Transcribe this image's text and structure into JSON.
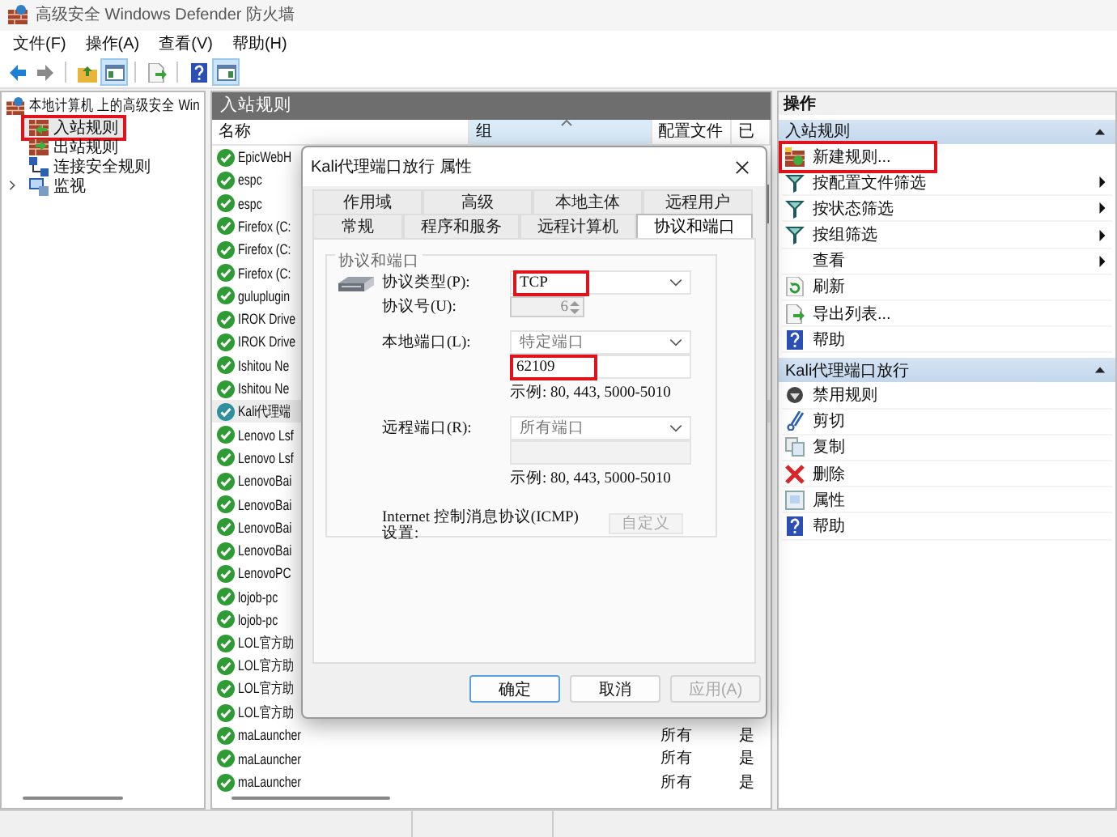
{
  "window": {
    "title": "高级安全 Windows Defender 防火墙"
  },
  "menu": [
    "文件(F)",
    "操作(A)",
    "查看(V)",
    "帮助(H)"
  ],
  "toolbar": [
    {
      "kind": "back",
      "pressed": false
    },
    {
      "kind": "forward",
      "pressed": false
    },
    {
      "kind": "separator"
    },
    {
      "kind": "up",
      "pressed": false
    },
    {
      "kind": "tree",
      "pressed": true
    },
    {
      "kind": "separator"
    },
    {
      "kind": "export",
      "pressed": false
    },
    {
      "kind": "separator"
    },
    {
      "kind": "help",
      "pressed": false
    },
    {
      "kind": "panel",
      "pressed": true
    }
  ],
  "tree": {
    "label": "本地计算机 上的高级安全 Win",
    "expanded": true,
    "children": [
      {
        "label": "入站规则",
        "kind": "inbound",
        "selected": true,
        "highlighted": true
      },
      {
        "label": "出站规则",
        "kind": "outbound",
        "selected": false,
        "highlighted": false
      },
      {
        "label": "连接安全规则",
        "kind": "connection",
        "selected": false,
        "highlighted": false
      },
      {
        "label": "监视",
        "kind": "monitor",
        "selected": false,
        "highlighted": false,
        "expanded": false
      }
    ]
  },
  "rules_pane": {
    "title": "入站规则",
    "columns": [
      {
        "label": "名称",
        "sorted": false
      },
      {
        "label": "组",
        "sorted": true
      },
      {
        "label": "配置文件",
        "sorted": false
      },
      {
        "label": "已",
        "sorted": false
      }
    ],
    "rows": [
      {
        "name": "EpicWebH",
        "selected": false
      },
      {
        "name": "espc",
        "selected": false
      },
      {
        "name": "espc",
        "selected": false
      },
      {
        "name": "Firefox (C:",
        "selected": false
      },
      {
        "name": "Firefox (C:",
        "selected": false
      },
      {
        "name": "Firefox (C:",
        "selected": false
      },
      {
        "name": "guluplugin",
        "selected": false
      },
      {
        "name": "IROK Drive",
        "selected": false
      },
      {
        "name": "IROK Drive",
        "selected": false
      },
      {
        "name": "Ishitou Ne",
        "selected": false
      },
      {
        "name": "Ishitou Ne",
        "selected": false
      },
      {
        "name": "Kali代理端",
        "selected": true
      },
      {
        "name": "Lenovo Lsf",
        "selected": false
      },
      {
        "name": "Lenovo Lsf",
        "selected": false
      },
      {
        "name": "LenovoBai",
        "selected": false
      },
      {
        "name": "LenovoBai",
        "selected": false
      },
      {
        "name": "LenovoBai",
        "selected": false
      },
      {
        "name": "LenovoBai",
        "selected": false
      },
      {
        "name": "LenovoPC",
        "selected": false
      },
      {
        "name": "lojob-pc",
        "selected": false
      },
      {
        "name": "lojob-pc",
        "selected": false
      },
      {
        "name": "LOL官方助",
        "selected": false
      },
      {
        "name": "LOL官方助",
        "selected": false
      },
      {
        "name": "LOL官方助",
        "selected": false
      },
      {
        "name": "LOL官方助",
        "selected": false
      },
      {
        "name": "maLauncher",
        "profile": "所有",
        "column_4": "是",
        "selected": false
      },
      {
        "name": "maLauncher",
        "profile": "所有",
        "column_4": "是",
        "selected": false
      },
      {
        "name": "maLauncher",
        "profile": "所有",
        "column_4": "是",
        "selected": false
      }
    ]
  },
  "actions": {
    "title": "操作",
    "sections": [
      {
        "title": "入站规则",
        "expanded": true,
        "items": [
          {
            "label": "新建规则...",
            "kind": "new",
            "submenu": false,
            "highlighted": true
          },
          {
            "label": "按配置文件筛选",
            "kind": "filter",
            "submenu": true,
            "highlighted": false
          },
          {
            "label": "按状态筛选",
            "kind": "filter",
            "submenu": true,
            "highlighted": false
          },
          {
            "label": "按组筛选",
            "kind": "filter",
            "submenu": true,
            "highlighted": false
          },
          {
            "label": "查看",
            "kind": "none",
            "submenu": true,
            "highlighted": false
          },
          {
            "label": "刷新",
            "kind": "refresh",
            "submenu": false,
            "highlighted": false
          },
          {
            "label": "导出列表...",
            "kind": "export",
            "submenu": false,
            "highlighted": false
          },
          {
            "label": "帮助",
            "kind": "help",
            "submenu": false,
            "highlighted": false
          }
        ]
      },
      {
        "title": "Kali代理端口放行",
        "expanded": true,
        "items": [
          {
            "label": "禁用规则",
            "kind": "disable",
            "submenu": false,
            "highlighted": false
          },
          {
            "label": "剪切",
            "kind": "cut",
            "submenu": false,
            "highlighted": false
          },
          {
            "label": "复制",
            "kind": "copy",
            "submenu": false,
            "highlighted": false
          },
          {
            "label": "删除",
            "kind": "delete",
            "submenu": false,
            "highlighted": false
          },
          {
            "label": "属性",
            "kind": "properties",
            "submenu": false,
            "highlighted": false
          },
          {
            "label": "帮助",
            "kind": "help",
            "submenu": false,
            "highlighted": false
          }
        ]
      }
    ]
  },
  "dialog": {
    "title": "Kali代理端口放行 属性",
    "tab_rows": [
      [
        {
          "label": "作用域",
          "selected": false
        },
        {
          "label": "高级",
          "selected": false
        },
        {
          "label": "本地主体",
          "selected": false
        },
        {
          "label": "远程用户",
          "selected": false
        }
      ],
      [
        {
          "label": "常规",
          "selected": false
        },
        {
          "label": "程序和服务",
          "selected": false
        },
        {
          "label": "远程计算机",
          "selected": false
        },
        {
          "label": "协议和端口",
          "selected": true
        }
      ]
    ],
    "group_title": "协议和端口",
    "protocol_type": {
      "label": "协议类型(P):",
      "value": "TCP",
      "highlighted": true
    },
    "protocol_number": {
      "label": "协议号(U):",
      "value": "6",
      "disabled": true
    },
    "local_port": {
      "label": "本地端口(L):",
      "value": "特定端口",
      "port": "62109",
      "port_highlighted": true,
      "port_disabled": false,
      "example": "示例: 80, 443, 5000-5010"
    },
    "remote_port": {
      "label": "远程端口(R):",
      "value": "所有端口",
      "port_highlighted": false,
      "port_disabled": true,
      "example": "示例: 80, 443, 5000-5010"
    },
    "icmp": {
      "label": "Internet 控制消息协议(ICMP)设置:",
      "button": "自定义",
      "disabled": true
    },
    "buttons": [
      {
        "label": "确定",
        "default": true,
        "disabled": false
      },
      {
        "label": "取消",
        "default": false,
        "disabled": false
      },
      {
        "label": "应用(A)",
        "default": false,
        "disabled": true
      }
    ]
  }
}
